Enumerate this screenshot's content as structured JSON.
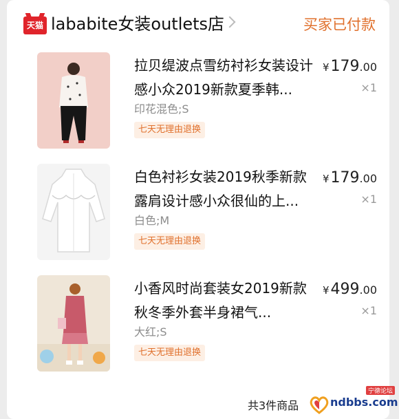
{
  "shop": {
    "logo_text": "天猫",
    "name": "lababite女装outlets店",
    "status": "买家已付款"
  },
  "items": [
    {
      "title": "拉贝缇波点雪纺衬衫女装设计感小众2019新款夏季韩...",
      "spec": "印花混色;S",
      "tag": "七天无理由退换",
      "currency": "¥",
      "price_int": "179",
      "price_dec": ".00",
      "qty": "×1"
    },
    {
      "title": "白色衬衫女装2019秋季新款露肩设计感小众很仙的上...",
      "spec": "白色;M",
      "tag": "七天无理由退换",
      "currency": "¥",
      "price_int": "179",
      "price_dec": ".00",
      "qty": "×1"
    },
    {
      "title": "小香风时尚套装女2019新款秋冬季外套半身裙气...",
      "spec": "大红;S",
      "tag": "七天无理由退换",
      "currency": "¥",
      "price_int": "499",
      "price_dec": ".00",
      "qty": "×1"
    }
  ],
  "footer": {
    "total_label": "共3件商品"
  },
  "watermark": {
    "text": "ndbbs.com",
    "badge": "宁德论坛"
  },
  "colors": {
    "accent": "#e0702c",
    "tmall_red": "#e0242b",
    "tag_bg": "#fdefe4"
  }
}
